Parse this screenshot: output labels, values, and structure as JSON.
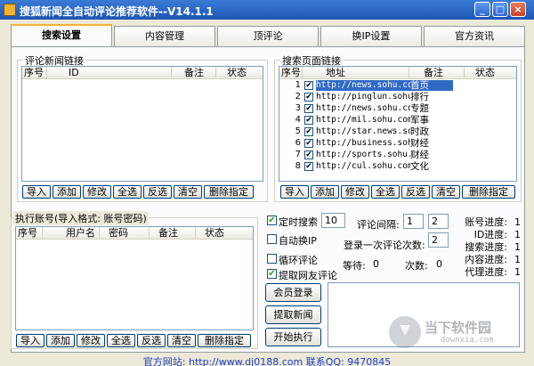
{
  "window": {
    "title": "搜狐新闻全自动评论推荐软件--V14.1.1",
    "minimize": "_",
    "maximize": "□",
    "close": "×"
  },
  "tabs": [
    {
      "label": "搜索设置"
    },
    {
      "label": "内容管理"
    },
    {
      "label": "顶评论"
    },
    {
      "label": "换IP设置"
    },
    {
      "label": "官方资讯"
    }
  ],
  "comment_links": {
    "title": "评论新闻链接",
    "columns": [
      "序号",
      "ID",
      "备注",
      "状态"
    ]
  },
  "search_links": {
    "title": "搜索页面链接",
    "columns": [
      "序号",
      "地址",
      "备注",
      "状态"
    ],
    "rows": [
      {
        "index": "1",
        "checked": true,
        "url": "http://news.sohu.co",
        "note": "首页"
      },
      {
        "index": "2",
        "checked": true,
        "url": "http://pinglun.sohu",
        "note": "排行"
      },
      {
        "index": "3",
        "checked": true,
        "url": "http://news.sohu.co",
        "note": "专题"
      },
      {
        "index": "4",
        "checked": true,
        "url": "http://mil.sohu.com",
        "note": "军事"
      },
      {
        "index": "5",
        "checked": true,
        "url": "http://star.news.so",
        "note": "时政"
      },
      {
        "index": "6",
        "checked": true,
        "url": "http://business.soh",
        "note": "财经"
      },
      {
        "index": "7",
        "checked": true,
        "url": "http://sports.sohu.",
        "note": "财经"
      },
      {
        "index": "8",
        "checked": true,
        "url": "http://cul.sohu.com",
        "note": "文化"
      }
    ]
  },
  "accounts": {
    "title": "执行账号(导入格式: 账号密码)",
    "columns": [
      "序号",
      "用户名",
      "密码",
      "备注",
      "状态"
    ]
  },
  "toolbar_buttons": [
    "导入",
    "添加",
    "修改",
    "全选",
    "反选",
    "清空",
    "删除指定"
  ],
  "settings": {
    "timed_search_label": "定时搜索",
    "timed_search_checked": true,
    "timed_search_value": "10",
    "auto_ip_label": "自动换IP",
    "auto_ip_checked": false,
    "loop_label": "循环评论",
    "loop_checked": false,
    "fetch_comments_label": "提取网友评论",
    "fetch_comments_checked": true,
    "interval_label": "评论间隔:",
    "interval_min": "1",
    "interval_max": "2",
    "login_times_label": "登录一次评论次数:",
    "login_times_value": "2",
    "wait_label": "等待:",
    "wait_value": "0",
    "count_label": "次数:",
    "count_value": "0"
  },
  "progress": [
    {
      "label": "账号进度:",
      "value": "1"
    },
    {
      "label": "ID进度:",
      "value": "1"
    },
    {
      "label": "搜索进度:",
      "value": "1"
    },
    {
      "label": "内容进度:",
      "value": "1"
    },
    {
      "label": "代理进度:",
      "value": "1"
    }
  ],
  "actions": {
    "login": "会员登录",
    "fetch_news": "提取新闻",
    "start": "开始执行"
  },
  "footer": "官方网站: http://www.dj0188.com 联系QQ: 9470845",
  "watermark": {
    "text": "当下软件园",
    "sub": "downxia.com"
  },
  "colors": {
    "titlebar": "#2a64d0",
    "selection": "#316ac5",
    "footer_text": "#1a3cc8",
    "active_tab_accent": "#f7b03d"
  }
}
